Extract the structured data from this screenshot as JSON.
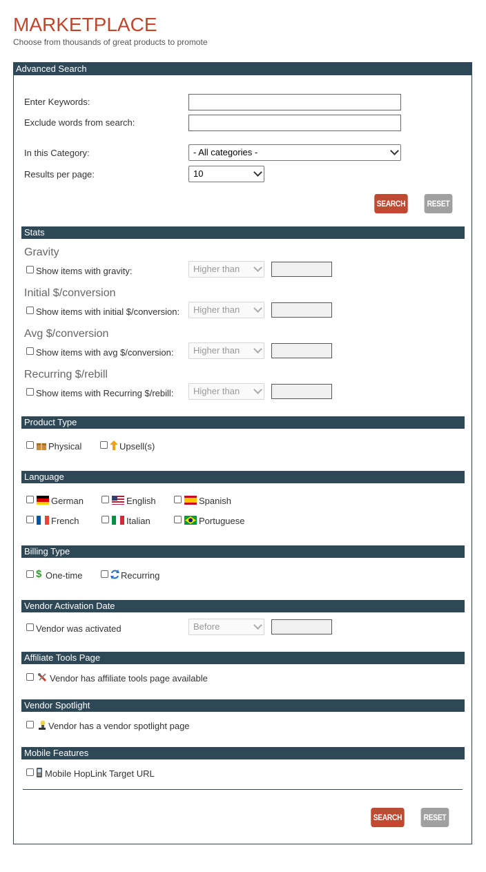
{
  "header": {
    "title": "MARKETPLACE",
    "subtitle": "Choose from thousands of great products to promote"
  },
  "advanced_search": {
    "title": "Advanced Search",
    "keywords_label": "Enter Keywords:",
    "keywords_value": "",
    "exclude_label": "Exclude words from search:",
    "exclude_value": "",
    "category_label": "In this Category:",
    "category_value": "- All categories -",
    "results_label": "Results per page:",
    "results_value": "10",
    "search_label": "SEARCH",
    "reset_label": "RESET"
  },
  "stats": {
    "title": "Stats",
    "gravity": {
      "heading": "Gravity",
      "label": "Show items with gravity:",
      "compare": "Higher than"
    },
    "initial": {
      "heading": "Initial $/conversion",
      "label": "Show items with initial $/conversion:",
      "compare": "Higher than"
    },
    "avg": {
      "heading": "Avg $/conversion",
      "label": "Show items with avg $/conversion:",
      "compare": "Higher than"
    },
    "recurring": {
      "heading": "Recurring $/rebill",
      "label": "Show items with Recurring $/rebill:",
      "compare": "Higher than"
    }
  },
  "product_type": {
    "title": "Product Type",
    "physical": "Physical",
    "upsells": "Upsell(s)"
  },
  "language": {
    "title": "Language",
    "german": "German",
    "english": "English",
    "spanish": "Spanish",
    "french": "French",
    "italian": "Italian",
    "portuguese": "Portuguese"
  },
  "billing_type": {
    "title": "Billing Type",
    "onetime": "One-time",
    "recurring": "Recurring"
  },
  "vendor_activation": {
    "title": "Vendor Activation Date",
    "label": "Vendor was activated",
    "compare": "Before"
  },
  "affiliate_tools": {
    "title": "Affiliate Tools Page",
    "label": "Vendor has affiliate tools page available"
  },
  "vendor_spotlight": {
    "title": "Vendor Spotlight",
    "label": "Vendor has a vendor spotlight page"
  },
  "mobile": {
    "title": "Mobile Features",
    "label": "Mobile HopLink Target URL"
  },
  "footer_buttons": {
    "search_label": "SEARCH",
    "reset_label": "RESET"
  },
  "colors": {
    "accent": "#c0462b",
    "bar": "#2e4858",
    "reset": "#a0a0a0"
  }
}
